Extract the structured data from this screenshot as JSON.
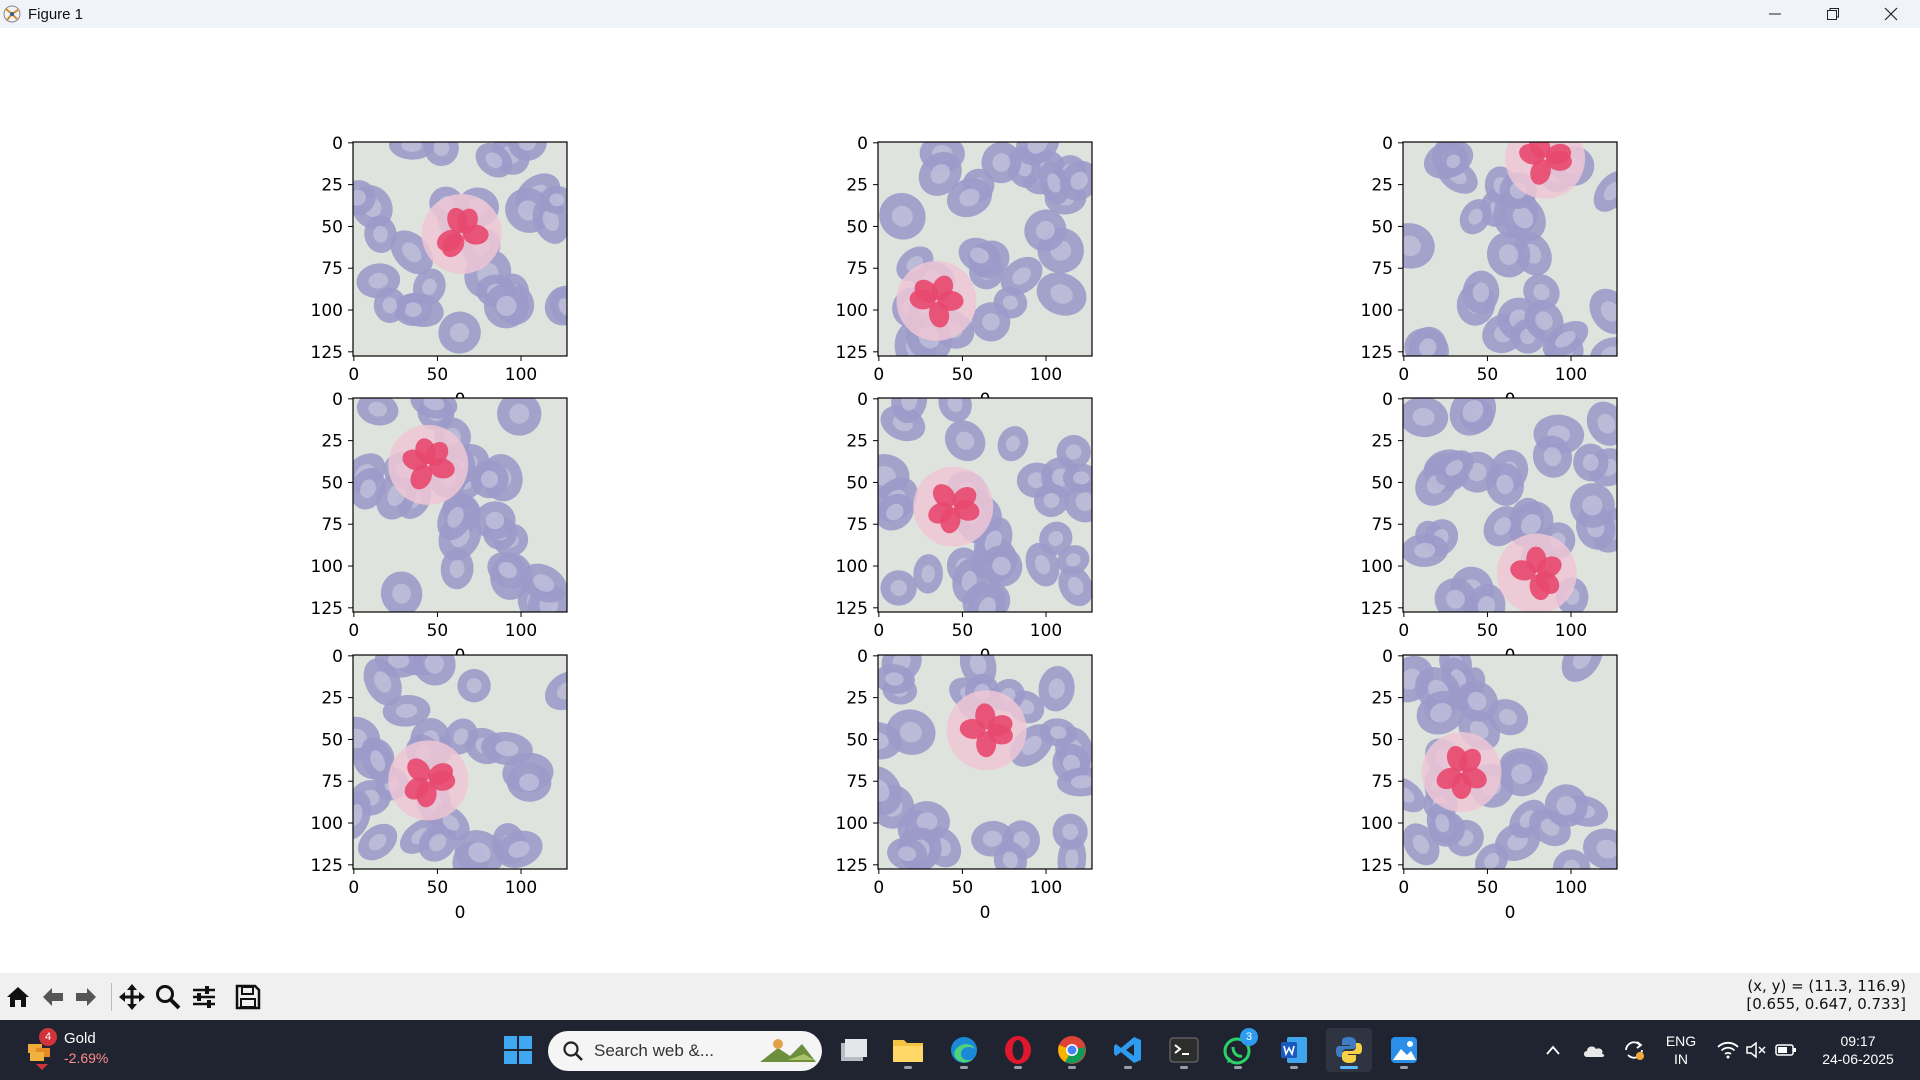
{
  "window": {
    "title": "Figure 1"
  },
  "figure": {
    "tick_labels_x": [
      "0",
      "50",
      "100"
    ],
    "tick_labels_y": [
      "0",
      "25",
      "50",
      "75",
      "100",
      "125"
    ],
    "column_xlabel": "0"
  },
  "chart_data": {
    "type": "image-grid",
    "rows": 3,
    "cols": 3,
    "panels": [
      {
        "cell_x_center": 65,
        "cell_y_center": 55,
        "image_size": 128
      },
      {
        "cell_x_center": 35,
        "cell_y_center": 95,
        "image_size": 128
      },
      {
        "cell_x_center": 85,
        "cell_y_center": 10,
        "image_size": 128
      },
      {
        "cell_x_center": 45,
        "cell_y_center": 40,
        "image_size": 128
      },
      {
        "cell_x_center": 45,
        "cell_y_center": 65,
        "image_size": 128
      },
      {
        "cell_x_center": 80,
        "cell_y_center": 105,
        "image_size": 128
      },
      {
        "cell_x_center": 45,
        "cell_y_center": 75,
        "image_size": 128
      },
      {
        "cell_x_center": 65,
        "cell_y_center": 45,
        "image_size": 128
      },
      {
        "cell_x_center": 35,
        "cell_y_center": 70,
        "image_size": 128
      }
    ],
    "xlim": [
      0,
      128
    ],
    "ylim": [
      128,
      0
    ],
    "x_ticks": [
      0,
      50,
      100
    ],
    "y_ticks": [
      0,
      25,
      50,
      75,
      100,
      125
    ]
  },
  "toolbar": {
    "coords_line1": "(x, y) = (11.3, 116.9)",
    "coords_line2": "[0.655, 0.647, 0.733]",
    "tools": [
      "home-icon",
      "back-icon",
      "forward-icon",
      "pan-icon",
      "zoom-icon",
      "configure-icon",
      "save-icon"
    ]
  },
  "taskbar": {
    "weather_name": "Gold",
    "weather_change": "-2.69%",
    "weather_badge": "4",
    "search_placeholder": "Search web &...",
    "whatsapp_badge": "3",
    "lang_line1": "ENG",
    "lang_line2": "IN",
    "time": "09:17",
    "date": "24-06-2025"
  },
  "colors": {
    "background": "#dfe3de",
    "rbc": "#9c9ac9",
    "rbc_center": "#cfcfe4",
    "nucleus": "#e8486e",
    "cytoplasm": "#efc7d6",
    "taskbar": "#1f2430"
  }
}
